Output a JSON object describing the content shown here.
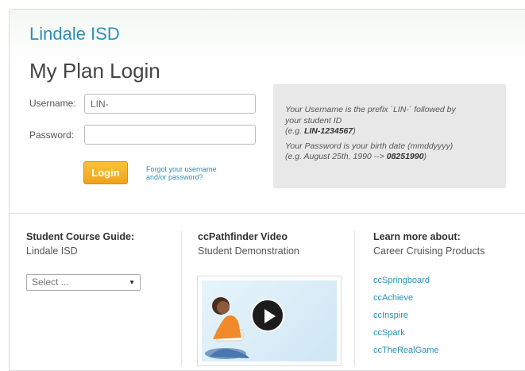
{
  "district": "Lindale ISD",
  "title": "My Plan Login",
  "login": {
    "username_label": "Username:",
    "username_value": "LIN-",
    "password_label": "Password:",
    "password_value": "",
    "button_label": "Login",
    "forgot_line1": "Forgot your username",
    "forgot_line2": "and/or password?"
  },
  "info": {
    "line1": "Your Username is the prefix `LIN-` followed by",
    "line2": "your student ID",
    "line3_prefix": "(e.g. ",
    "line3_bold": "LIN-1234567",
    "line3_suffix": ")",
    "line4": "Your Password is your birth date (mmddyyyy)",
    "line5_prefix": "(e.g. August 25th, 1990 --> ",
    "line5_bold": "08251990",
    "line5_suffix": ")"
  },
  "course_guide": {
    "title": "Student Course Guide:",
    "subtitle": "Lindale ISD",
    "select_value": "Select ..."
  },
  "video": {
    "title": "ccPathfinder Video",
    "subtitle": "Student Demonstration"
  },
  "learn_more": {
    "title": "Learn more about:",
    "subtitle": "Career Cruising Products",
    "links": [
      "ccSpringboard",
      "ccAchieve",
      "ccInspire",
      "ccSpark",
      "ccTheRealGame"
    ]
  },
  "colors": {
    "accent": "#2a8fb8",
    "button": "#f0a21c",
    "info_bg": "#e8e8e8"
  }
}
